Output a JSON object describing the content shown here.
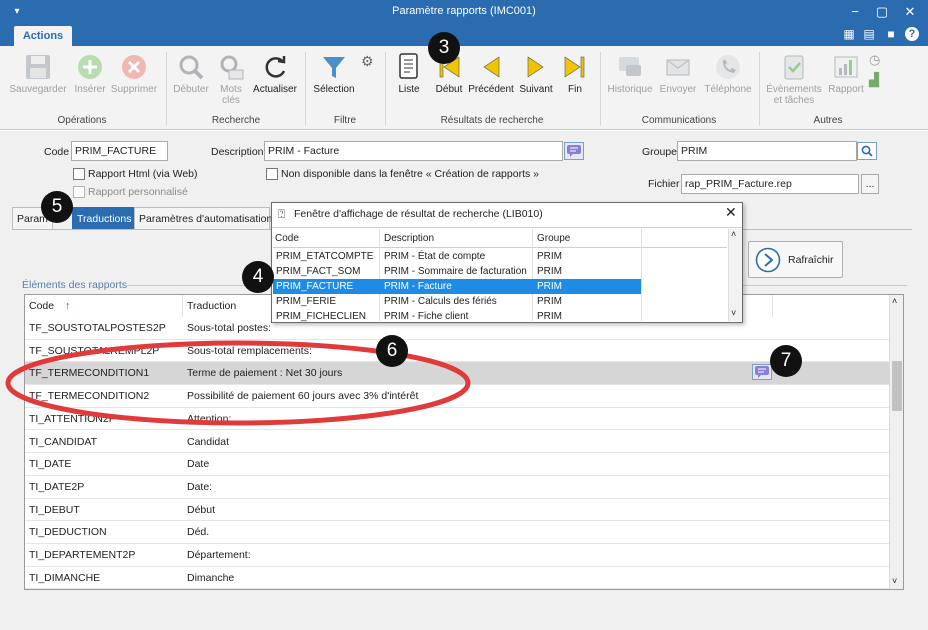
{
  "window": {
    "title": "Paramètre rapports (IMC001)",
    "controls": [
      "−",
      "▢",
      "✕"
    ]
  },
  "ribbon_tab": "Actions",
  "ribbon": {
    "operations": {
      "group": "Opérations",
      "save": "Sauvegarder",
      "insert": "Insérer",
      "delete": "Supprimer"
    },
    "recherche": {
      "group": "Recherche",
      "start": "Débuter",
      "keywords_1": "Mots",
      "keywords_2": "clés",
      "refresh": "Actualiser"
    },
    "filtre": {
      "group": "Filtre",
      "selection": "Sélection"
    },
    "resultats": {
      "group": "Résultats de recherche",
      "list": "Liste",
      "first": "Début",
      "prev": "Précédent",
      "next": "Suivant",
      "last": "Fin"
    },
    "communications": {
      "group": "Communications",
      "history": "Historique",
      "send": "Envoyer",
      "phone": "Téléphone"
    },
    "autres": {
      "group": "Autres",
      "events_1": "Évènements",
      "events_2": "et tâches",
      "report": "Rapport"
    }
  },
  "form": {
    "code_label": "Code",
    "code_value": "PRIM_FACTURE",
    "description_label": "Description",
    "description_value": "PRIM - Facture",
    "group_label": "Groupe",
    "group_value": "PRIM",
    "file_label": "Fichier",
    "file_value": "rap_PRIM_Facture.rep",
    "file_browse": "...",
    "html_report": "Rapport Html (via Web)",
    "custom_report": "Rapport personnalisé",
    "not_available": "Non disponible dans la fenêtre « Création de rapports »"
  },
  "subtabs": {
    "params": "Param",
    "translations": "Traductions",
    "automation": "Paramètres d'automatisation"
  },
  "refresh_button": "Rafraîchir",
  "section_label": "Éléments des rapports",
  "grid": {
    "col_code": "Code",
    "col_translation": "Traduction",
    "rows": [
      {
        "code": "TF_SOUSTOTALPOSTES2P",
        "translation": "Sous-total postes:"
      },
      {
        "code": "TF_SOUSTOTALREMPL2P",
        "translation": "Sous-total remplacements:"
      },
      {
        "code": "TF_TERMECONDITION1",
        "translation": "Terme de paiement : Net 30 jours"
      },
      {
        "code": "TF_TERMECONDITION2",
        "translation": "Possibilité de paiement 60 jours avec 3% d'intérêt"
      },
      {
        "code": "TI_ATTENTION2P",
        "translation": "Attention:"
      },
      {
        "code": "TI_CANDIDAT",
        "translation": "Candidat"
      },
      {
        "code": "TI_DATE",
        "translation": "Date"
      },
      {
        "code": "TI_DATE2P",
        "translation": "Date:"
      },
      {
        "code": "TI_DEBUT",
        "translation": "Début"
      },
      {
        "code": "TI_DEDUCTION",
        "translation": "Déd."
      },
      {
        "code": "TI_DEPARTEMENT2P",
        "translation": "Département:"
      },
      {
        "code": "TI_DIMANCHE",
        "translation": "Dimanche"
      }
    ]
  },
  "popup": {
    "title": "Fenêtre d'affichage de résultat de recherche (LIB010)",
    "col_code": "Code",
    "col_description": "Description",
    "col_group": "Groupe",
    "rows": [
      {
        "code": "PRIM_ETATCOMPTE",
        "description": "PRIM - État de compte",
        "group": "PRIM"
      },
      {
        "code": "PRIM_FACT_SOM",
        "description": "PRIM - Sommaire de facturation",
        "group": "PRIM"
      },
      {
        "code": "PRIM_FACTURE",
        "description": "PRIM - Facture",
        "group": "PRIM"
      },
      {
        "code": "PRIM_FERIE",
        "description": "PRIM - Calculs des fériés",
        "group": "PRIM"
      },
      {
        "code": "PRIM_FICHECLIEN",
        "description": "PRIM - Fiche client",
        "group": "PRIM"
      }
    ]
  },
  "callouts": [
    "3",
    "4",
    "5",
    "6",
    "7"
  ],
  "colors": {
    "titlebar": "#2b6cb0",
    "selection": "#1e8ce6",
    "annotation": "#e03a3a",
    "nav_arrow": "#f0c400"
  }
}
